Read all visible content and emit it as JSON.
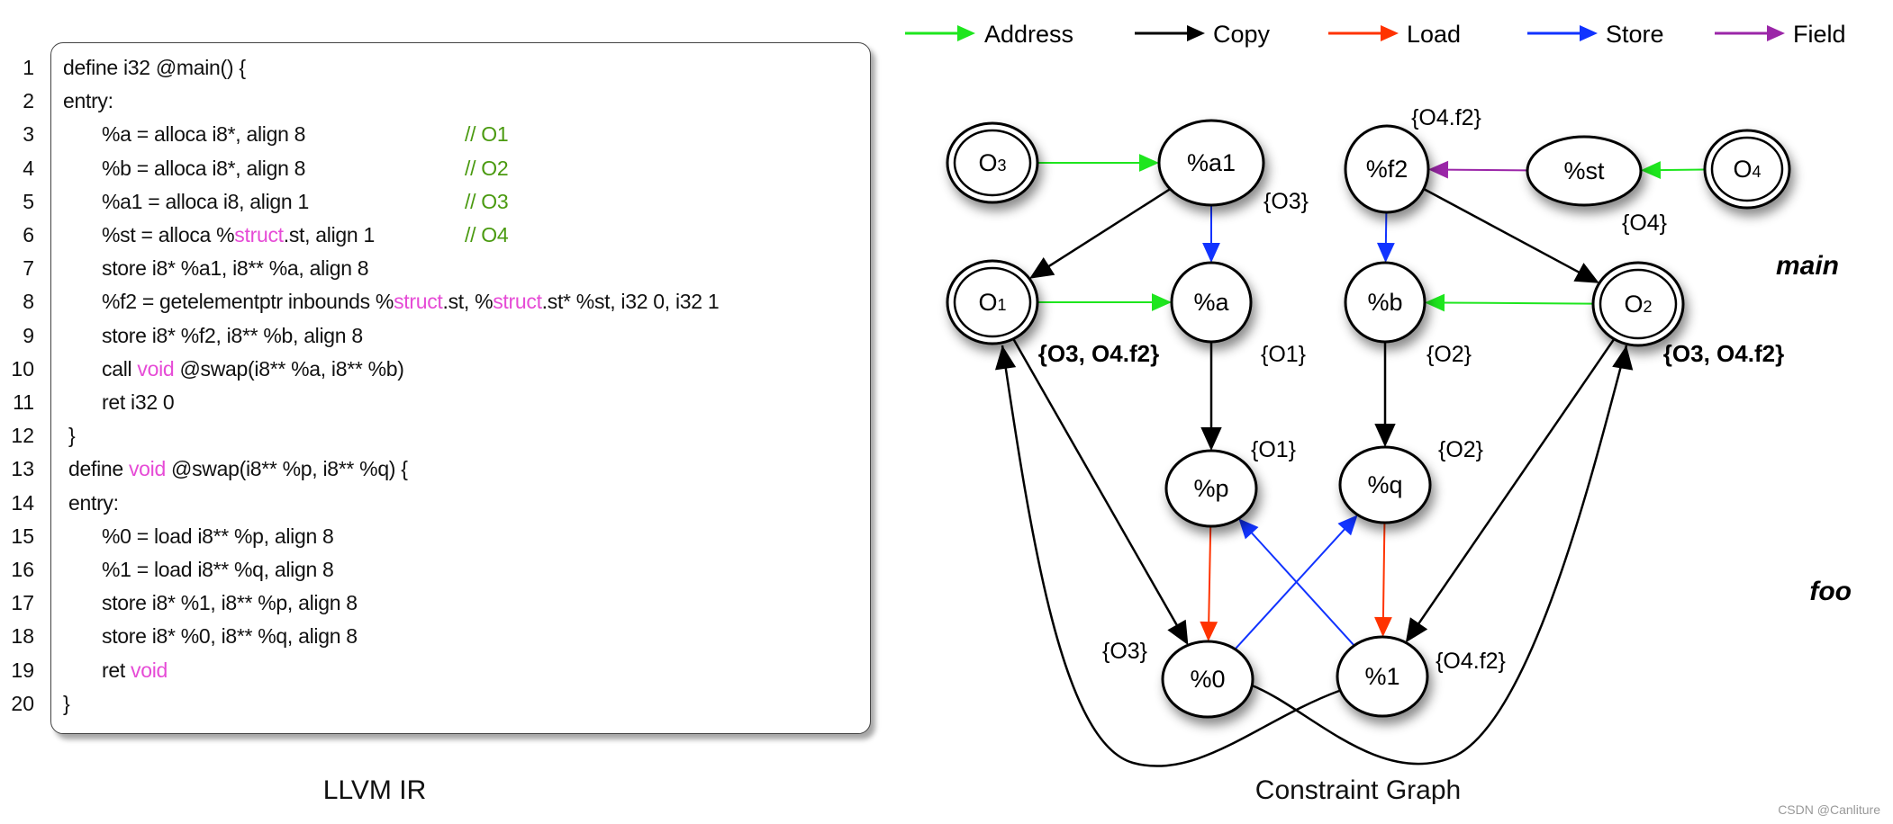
{
  "code": {
    "lines": [
      {
        "n": "1",
        "indent": 0,
        "segs": [
          {
            "t": "define i32 @main() {",
            "k": "plain"
          }
        ]
      },
      {
        "n": "2",
        "indent": 0,
        "segs": [
          {
            "t": "entry:",
            "k": "plain"
          }
        ]
      },
      {
        "n": "3",
        "indent": 2,
        "segs": [
          {
            "t": "%a = alloca i8*, align 8",
            "k": "plain"
          }
        ],
        "comment": "// O1"
      },
      {
        "n": "4",
        "indent": 2,
        "segs": [
          {
            "t": "%b = alloca i8*, align 8",
            "k": "plain"
          }
        ],
        "comment": "// O2"
      },
      {
        "n": "5",
        "indent": 2,
        "segs": [
          {
            "t": "%a1 = alloca i8, align 1",
            "k": "plain"
          }
        ],
        "comment": "// O3"
      },
      {
        "n": "6",
        "indent": 2,
        "segs": [
          {
            "t": "%st = alloca %",
            "k": "plain"
          },
          {
            "t": "struct",
            "k": "kw"
          },
          {
            "t": ".st, align 1",
            "k": "plain"
          }
        ],
        "comment": "// O4"
      },
      {
        "n": "7",
        "indent": 2,
        "segs": [
          {
            "t": "store i8* %a1, i8** %a, align 8",
            "k": "plain"
          }
        ]
      },
      {
        "n": "8",
        "indent": 2,
        "segs": [
          {
            "t": "%f2 = getelementptr inbounds %",
            "k": "plain"
          },
          {
            "t": "struct",
            "k": "kw"
          },
          {
            "t": ".st, %",
            "k": "plain"
          },
          {
            "t": "struct",
            "k": "kw"
          },
          {
            "t": ".st* %st, i32 0, i32 1",
            "k": "plain"
          }
        ]
      },
      {
        "n": "9",
        "indent": 2,
        "segs": [
          {
            "t": "store i8* %f2, i8** %b, align 8",
            "k": "plain"
          }
        ]
      },
      {
        "n": "10",
        "indent": 2,
        "segs": [
          {
            "t": "call ",
            "k": "plain"
          },
          {
            "t": "void",
            "k": "kw"
          },
          {
            "t": " @swap(i8** %a, i8** %b)",
            "k": "plain"
          }
        ]
      },
      {
        "n": "11",
        "indent": 2,
        "segs": [
          {
            "t": "ret i32 0",
            "k": "plain"
          }
        ]
      },
      {
        "n": "12",
        "indent": 1,
        "segs": [
          {
            "t": "}",
            "k": "plain"
          }
        ]
      },
      {
        "n": "13",
        "indent": 1,
        "segs": [
          {
            "t": "define ",
            "k": "plain"
          },
          {
            "t": "void",
            "k": "kw"
          },
          {
            "t": " @swap(i8** %p, i8** %q) {",
            "k": "plain"
          }
        ]
      },
      {
        "n": "14",
        "indent": 1,
        "segs": [
          {
            "t": "entry:",
            "k": "plain"
          }
        ]
      },
      {
        "n": "15",
        "indent": 2,
        "segs": [
          {
            "t": "%0 = load i8** %p, align 8",
            "k": "plain"
          }
        ]
      },
      {
        "n": "16",
        "indent": 2,
        "segs": [
          {
            "t": "%1 = load i8** %q, align 8",
            "k": "plain"
          }
        ]
      },
      {
        "n": "17",
        "indent": 2,
        "segs": [
          {
            "t": "store i8* %1, i8** %p, align 8",
            "k": "plain"
          }
        ]
      },
      {
        "n": "18",
        "indent": 2,
        "segs": [
          {
            "t": "store i8* %0, i8** %q, align 8",
            "k": "plain"
          }
        ]
      },
      {
        "n": "19",
        "indent": 2,
        "segs": [
          {
            "t": "ret ",
            "k": "plain"
          },
          {
            "t": "void",
            "k": "kw"
          }
        ]
      },
      {
        "n": "20",
        "indent": 0,
        "segs": [
          {
            "t": "}",
            "k": "plain"
          }
        ]
      }
    ],
    "caption": "LLVM IR"
  },
  "graph": {
    "caption": "Constraint Graph",
    "legend": [
      {
        "kind": "address",
        "label": "Address",
        "color": "#1ee61e"
      },
      {
        "kind": "copy",
        "label": "Copy",
        "color": "#000000"
      },
      {
        "kind": "load",
        "label": "Load",
        "color": "#ff3300"
      },
      {
        "kind": "store",
        "label": "Store",
        "color": "#1133ff"
      },
      {
        "kind": "field",
        "label": "Field",
        "color": "#9b26a8"
      }
    ],
    "nodes": [
      {
        "id": "O3",
        "label": "O",
        "sub": "3",
        "object": true
      },
      {
        "id": "a1",
        "label": "%a1",
        "object": false
      },
      {
        "id": "f2",
        "label": "%f2",
        "object": false
      },
      {
        "id": "st",
        "label": "%st",
        "object": false
      },
      {
        "id": "O4",
        "label": "O",
        "sub": "4",
        "object": true
      },
      {
        "id": "O1",
        "label": "O",
        "sub": "1",
        "object": true
      },
      {
        "id": "a",
        "label": "%a",
        "object": false
      },
      {
        "id": "b",
        "label": "%b",
        "object": false
      },
      {
        "id": "O2",
        "label": "O",
        "sub": "2",
        "object": true
      },
      {
        "id": "p",
        "label": "%p",
        "object": false
      },
      {
        "id": "q",
        "label": "%q",
        "object": false
      },
      {
        "id": "v0",
        "label": "%0",
        "object": false
      },
      {
        "id": "v1",
        "label": "%1",
        "object": false
      }
    ],
    "edges": [
      {
        "from": "O3",
        "to": "a1",
        "kind": "address"
      },
      {
        "from": "O1",
        "to": "a",
        "kind": "address"
      },
      {
        "from": "O2",
        "to": "b",
        "kind": "address"
      },
      {
        "from": "O4",
        "to": "st",
        "kind": "address"
      },
      {
        "from": "st",
        "to": "f2",
        "kind": "field"
      },
      {
        "from": "a1",
        "to": "a",
        "kind": "store"
      },
      {
        "from": "f2",
        "to": "b",
        "kind": "store"
      },
      {
        "from": "v0",
        "to": "q",
        "kind": "store"
      },
      {
        "from": "v1",
        "to": "p",
        "kind": "store"
      },
      {
        "from": "a1",
        "to": "O1",
        "kind": "copy"
      },
      {
        "from": "f2",
        "to": "O2",
        "kind": "copy"
      },
      {
        "from": "a",
        "to": "p",
        "kind": "copy"
      },
      {
        "from": "b",
        "to": "q",
        "kind": "copy"
      },
      {
        "from": "O1",
        "to": "v0",
        "kind": "copy"
      },
      {
        "from": "O2",
        "to": "v1",
        "kind": "copy"
      },
      {
        "from": "v1",
        "to": "O1",
        "kind": "copy"
      },
      {
        "from": "v0",
        "to": "O2",
        "kind": "copy"
      },
      {
        "from": "p",
        "to": "v0",
        "kind": "load"
      },
      {
        "from": "q",
        "to": "v1",
        "kind": "load"
      }
    ],
    "pts_sets": [
      {
        "node": "a1",
        "text": "{O3}",
        "bold": false
      },
      {
        "node": "f2",
        "text": "{O4.f2}",
        "bold": false
      },
      {
        "node": "st",
        "text": "{O4}",
        "bold": false
      },
      {
        "node": "O1",
        "text": "{O3, O4.f2}",
        "bold": true
      },
      {
        "node": "a",
        "text": "{O1}",
        "bold": false
      },
      {
        "node": "b",
        "text": "{O2}",
        "bold": false
      },
      {
        "node": "O2",
        "text": "{O3, O4.f2}",
        "bold": true
      },
      {
        "node": "p",
        "text": "{O1}",
        "bold": false
      },
      {
        "node": "q",
        "text": "{O2}",
        "bold": false
      },
      {
        "node": "v0",
        "text": "{O3}",
        "bold": false
      },
      {
        "node": "v1",
        "text": "{O4.f2}",
        "bold": false
      }
    ],
    "regions": [
      {
        "id": "main",
        "label": "main"
      },
      {
        "id": "foo",
        "label": "foo"
      }
    ]
  },
  "watermark": "CSDN @Canliture"
}
